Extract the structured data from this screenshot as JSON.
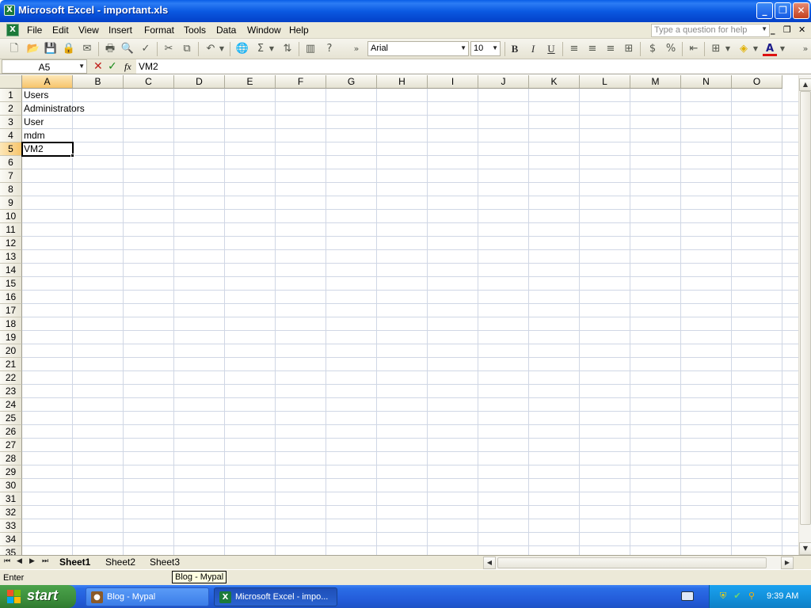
{
  "window": {
    "title": "Microsoft Excel - important.xls",
    "buttons": {
      "minimize": "_",
      "maximize": "❐",
      "close": "✕"
    }
  },
  "menu": {
    "items": [
      "File",
      "Edit",
      "View",
      "Insert",
      "Format",
      "Tools",
      "Data",
      "Window",
      "Help"
    ],
    "help_placeholder": "Type a question for help"
  },
  "toolbar": {
    "font_name": "Arial",
    "font_size": "10",
    "bold": "B",
    "italic": "I",
    "underline": "U"
  },
  "formula_bar": {
    "name_box": "A5",
    "fx": "fx",
    "content": "VM2"
  },
  "grid": {
    "columns": [
      "A",
      "B",
      "C",
      "D",
      "E",
      "F",
      "G",
      "H",
      "I",
      "J",
      "K",
      "L",
      "M",
      "N",
      "O"
    ],
    "selected_column": "A",
    "rows": [
      "1",
      "2",
      "3",
      "4",
      "5",
      "6",
      "7",
      "8",
      "9",
      "10",
      "11",
      "12",
      "13",
      "14",
      "15",
      "16",
      "17",
      "18",
      "19",
      "20",
      "21",
      "22",
      "23",
      "24",
      "25",
      "26",
      "27",
      "28",
      "29",
      "30",
      "31",
      "32",
      "33",
      "34",
      "35"
    ],
    "selected_row": "5",
    "cells_col_a": [
      "Users",
      "Administrators",
      "User",
      "mdm",
      "VM2"
    ]
  },
  "sheets": {
    "tabs": [
      "Sheet1",
      "Sheet2",
      "Sheet3"
    ],
    "active": "Sheet1"
  },
  "status": {
    "mode": "Enter"
  },
  "tooltip": "Blog - Mypal",
  "taskbar": {
    "start_label": "start",
    "tasks": [
      "Blog - Mypal",
      "Microsoft Excel - impo..."
    ],
    "clock": "9:39 AM"
  },
  "colors": {
    "title_blue": "#0a5ee8",
    "start_green": "#3c8e3c",
    "selected_header": "#f7c46a",
    "grid_line": "#d0d7e5"
  }
}
